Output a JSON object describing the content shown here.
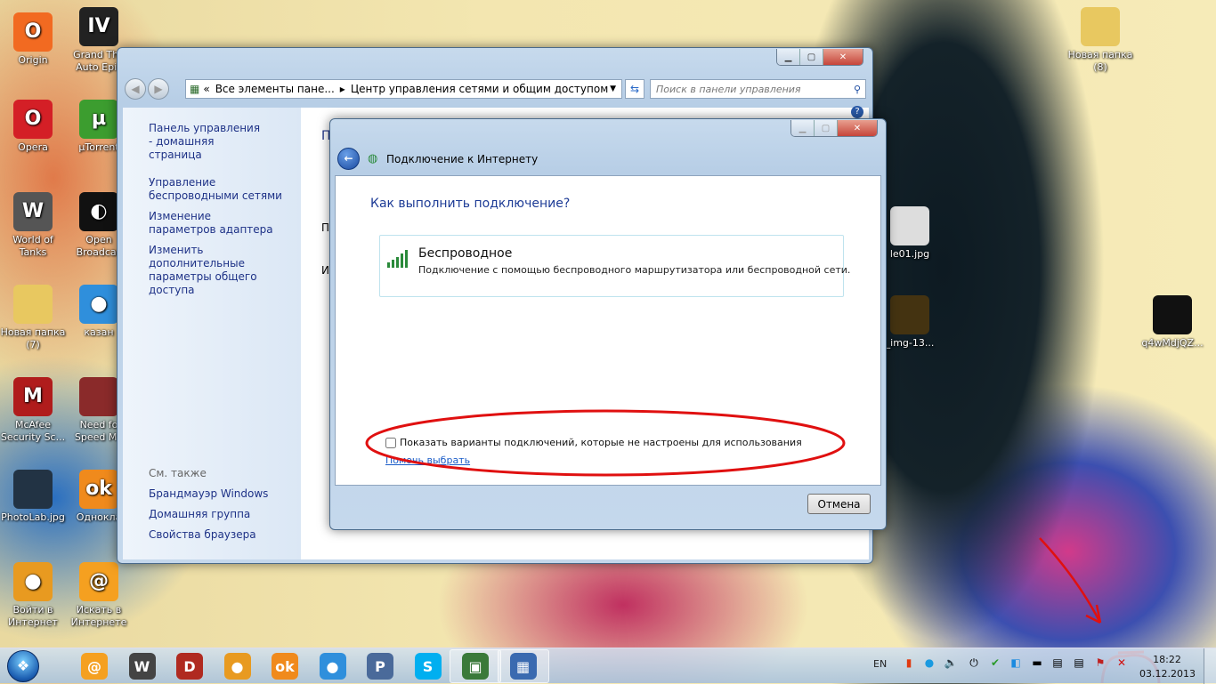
{
  "desktop_icons": [
    {
      "label": "Origin",
      "color": "#f26a21",
      "glyph": "O"
    },
    {
      "label": "Grand The Auto Epis",
      "color": "#222",
      "glyph": "IV"
    },
    {
      "label": "Opera",
      "color": "#d41f26",
      "glyph": "O"
    },
    {
      "label": "µTorrent",
      "color": "#3c9d2f",
      "glyph": "µ"
    },
    {
      "label": "World of Tanks",
      "color": "#555",
      "glyph": "W"
    },
    {
      "label": "Open Broadcas",
      "color": "#111",
      "glyph": "◐"
    },
    {
      "label": "Новая папка (7)",
      "color": "#e8c860",
      "glyph": ""
    },
    {
      "label": "казан",
      "color": "#2f8fdc",
      "glyph": "●"
    },
    {
      "label": "McAfee Security Sc...",
      "color": "#b01c1c",
      "glyph": "M"
    },
    {
      "label": "Need fo Speed Mo",
      "color": "#8a2a2a",
      "glyph": ""
    },
    {
      "label": "PhotoLab.jpg",
      "color": "#223344",
      "glyph": ""
    },
    {
      "label": "Однокла",
      "color": "#f08a1c",
      "glyph": "ok"
    },
    {
      "label": "Войти в Интернет",
      "color": "#e89a20",
      "glyph": "●"
    },
    {
      "label": "Искать в Интернете",
      "color": "#f5a020",
      "glyph": "@"
    },
    {
      "label": "Новая папка (8)",
      "color": "#e8c860",
      "glyph": ""
    },
    {
      "label": "le01.jpg",
      "color": "#ddd",
      "glyph": ""
    },
    {
      "label": "_img-13...",
      "color": "#443311",
      "glyph": ""
    },
    {
      "label": "q4wMdjQZ...",
      "color": "#111",
      "glyph": ""
    }
  ],
  "control_panel": {
    "breadcrumb_prefix": "«",
    "breadcrumb_1": "Все элементы пане...",
    "breadcrumb_sep": "▸",
    "breadcrumb_2": "Центр управления сетями и общим доступом",
    "search_placeholder": "Поиск в панели управления",
    "left_home": "Панель управления - домашняя страница",
    "left_links": [
      "Управление беспроводными сетями",
      "Изменение параметров адаптера",
      "Изменить дополнительные параметры общего доступа"
    ],
    "see_also": "См. также",
    "see_also_links": [
      "Брандмауэр Windows",
      "Домашняя группа",
      "Свойства браузера"
    ],
    "content_letters": [
      "П",
      "П",
      "И"
    ]
  },
  "dialog": {
    "title": "Подключение к Интернету",
    "heading": "Как выполнить подключение?",
    "option_title": "Беспроводное",
    "option_desc": "Подключение с помощью беспроводного маршрутизатора или беспроводной сети.",
    "checkbox_label": "Показать варианты подключений, которые не настроены для использования",
    "checkbox_checked": false,
    "help_link": "Помочь выбрать",
    "cancel": "Отмена"
  },
  "taskbar": {
    "pinned": [
      {
        "name": "mail-agent",
        "color": "#f5a020",
        "glyph": "@"
      },
      {
        "name": "world-of-tanks",
        "color": "#444",
        "glyph": "W"
      },
      {
        "name": "dota-2",
        "color": "#b02a20",
        "glyph": "D"
      },
      {
        "name": "browser-orb",
        "color": "#e89a20",
        "glyph": "●"
      },
      {
        "name": "odnoklassniki",
        "color": "#f08a1c",
        "glyph": "ok"
      },
      {
        "name": "chrome",
        "color": "#2f8fdc",
        "glyph": "●"
      },
      {
        "name": "p-app",
        "color": "#4a6a9a",
        "glyph": "P"
      },
      {
        "name": "skype",
        "color": "#00aff0",
        "glyph": "S"
      },
      {
        "name": "window-app",
        "color": "#3a7a3a",
        "glyph": "▣"
      },
      {
        "name": "control-panel",
        "color": "#3a6ab0",
        "glyph": "▦"
      }
    ],
    "language": "EN",
    "time": "18:22",
    "date": "03.12.2013"
  }
}
